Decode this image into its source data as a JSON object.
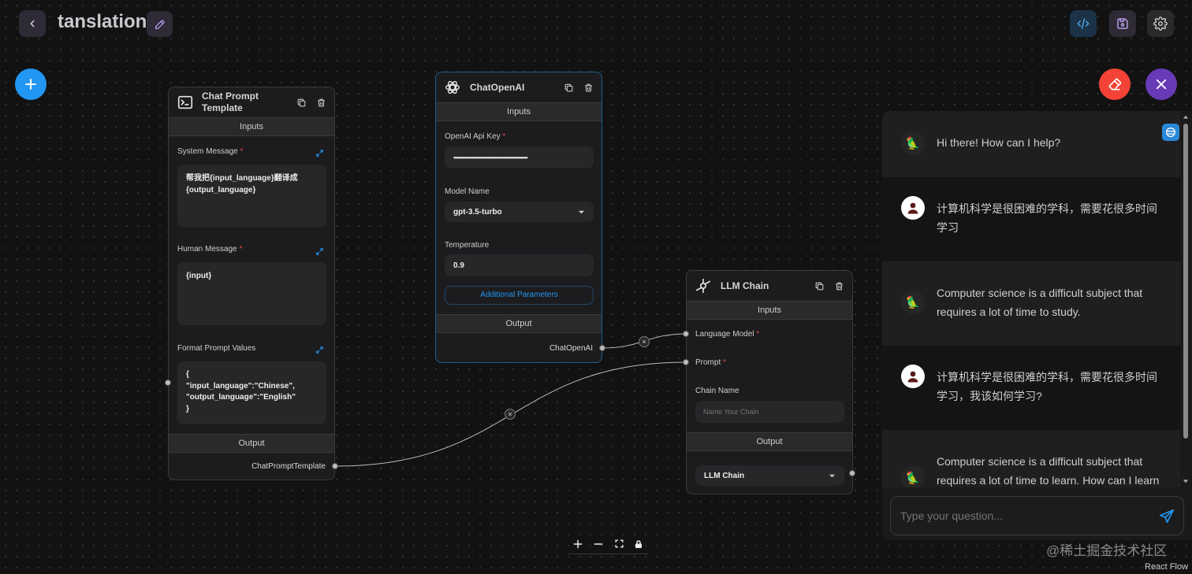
{
  "header": {
    "title": "tanslation",
    "back_icon": "chevron-left-icon",
    "edit_icon": "pencil-icon",
    "code_icon": "code-icon",
    "save_icon": "save-icon",
    "settings_icon": "gear-icon"
  },
  "colors": {
    "canvas": "#121212",
    "add_button": "#2196f3",
    "clear_button": "#f44336",
    "close_button": "#673ab7",
    "accent_link": "#2196f3"
  },
  "nodes": {
    "chat_prompt": {
      "title_line1": "Chat Prompt",
      "title_line2": "Template",
      "inputs_label": "Inputs",
      "system_message_label": "System Message",
      "system_message_value": "帮我把{input_language}翻译成\n{output_language}",
      "human_message_label": "Human Message",
      "human_message_value": "{input}",
      "format_values_label": "Format Prompt Values",
      "format_values_value": "{\n\"input_language\":\"Chinese\",\n\"output_language\":\"English\"\n}",
      "output_label": "Output",
      "output_handle": "ChatPromptTemplate",
      "required_mark": "*"
    },
    "chat_openai": {
      "title": "ChatOpenAI",
      "inputs_label": "Inputs",
      "api_key_label": "OpenAI Api Key",
      "api_key_value": "••••••••••••••••••••••••••••••••••••••••••••••••••••",
      "model_name_label": "Model Name",
      "model_name_value": "gpt-3.5-turbo",
      "temperature_label": "Temperature",
      "temperature_value": "0.9",
      "additional_params": "Additional Parameters",
      "output_label": "Output",
      "output_handle": "ChatOpenAI",
      "required_mark": "*"
    },
    "llm_chain": {
      "title": "LLM Chain",
      "inputs_label": "Inputs",
      "language_model_label": "Language Model",
      "prompt_label": "Prompt",
      "chain_name_label": "Chain Name",
      "chain_name_placeholder": "Name Your Chain",
      "output_label": "Output",
      "output_value": "LLM Chain",
      "required_mark": "*"
    }
  },
  "edges": {
    "remove_glyph": "×"
  },
  "chat": {
    "messages": [
      {
        "role": "bot",
        "text": "Hi there! How can I help?"
      },
      {
        "role": "user",
        "text": "计算机科学是很困难的学科，需要花很多时间学习"
      },
      {
        "role": "bot",
        "text": "Computer science is a difficult subject that requires a lot of time to study."
      },
      {
        "role": "user",
        "text": "计算机科学是很困难的学科，需要花很多时间学习，我该如何学习?"
      },
      {
        "role": "bot",
        "text": "Computer science is a difficult subject that requires a lot of time to learn. How can I learn"
      }
    ],
    "input_placeholder": "Type your question...",
    "bot_avatar": "🦜"
  },
  "controls": {
    "zoom_in": "+",
    "zoom_out": "−"
  },
  "watermark": "@稀土掘金技术社区",
  "attribution": "React Flow"
}
